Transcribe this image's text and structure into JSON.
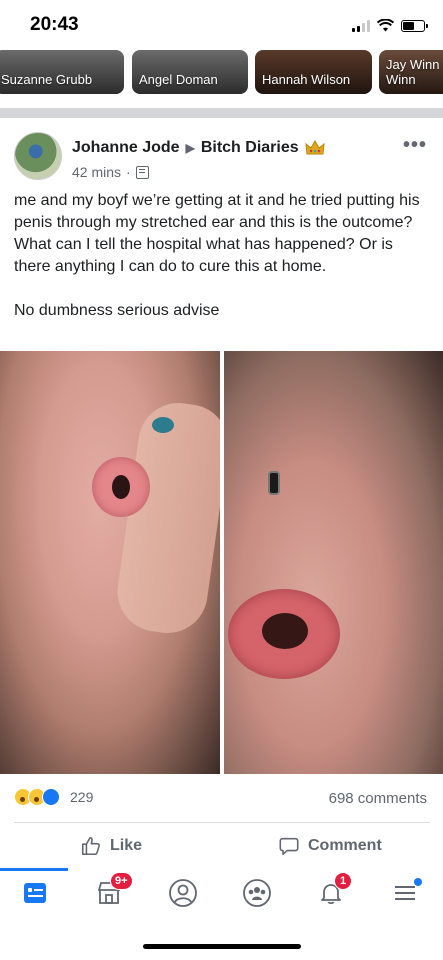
{
  "status_bar": {
    "time": "20:43"
  },
  "stories": [
    {
      "name": "Suzanne Grubb"
    },
    {
      "name": "Angel Doman"
    },
    {
      "name": "Hannah Wilson"
    },
    {
      "name": "Jay Winn Winn"
    }
  ],
  "post": {
    "author": "Johanne Jode",
    "group": "Bitch Diaries",
    "time": "42 mins",
    "meta_separator": "·",
    "paragraphs": [
      "me and my boyf we’re getting at it and he tried putting his penis through my stretched ear and this is the outcome? What can I tell the hospital what has happened? Or is there anything I can do to cure this at home.",
      "No dumbness serious advise"
    ],
    "reaction_count": "229",
    "comments_label": "698 comments",
    "like_label": "Like",
    "comment_label": "Comment"
  },
  "tabbar": {
    "marketplace_badge": "9+",
    "notifications_badge": "1"
  },
  "colors": {
    "accent": "#1877f2",
    "badge": "#e41e3f",
    "text_secondary": "#606770"
  },
  "icons": [
    "signal-icon",
    "wifi-icon",
    "battery-icon",
    "crown-icon",
    "globe-icon",
    "more-icon",
    "like-icon",
    "comment-icon",
    "feed-icon",
    "marketplace-icon",
    "profile-icon",
    "groups-icon",
    "bell-icon",
    "menu-icon"
  ]
}
